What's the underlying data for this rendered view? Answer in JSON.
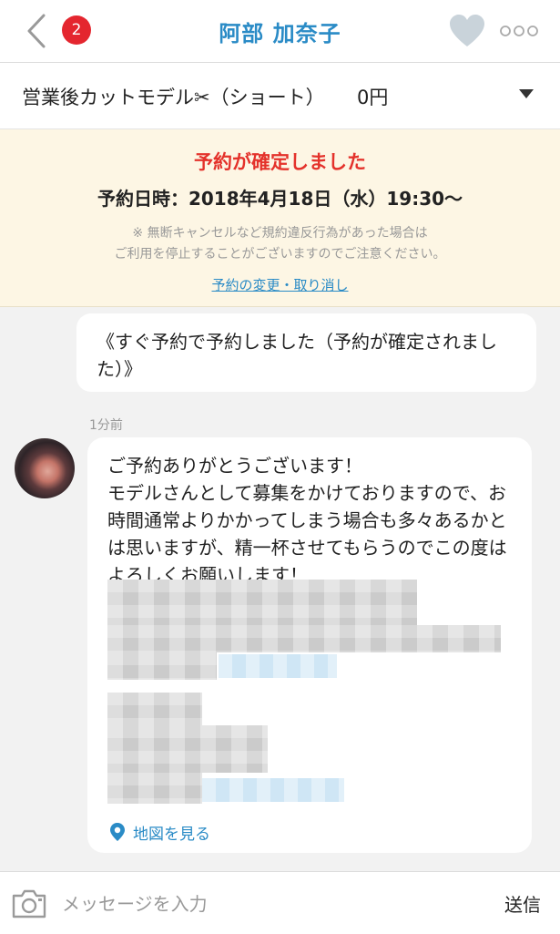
{
  "header": {
    "title": "阿部 加奈子",
    "unread_count": "2",
    "back_icon": "chevron-left-icon",
    "favorite_icon": "heart-icon",
    "more_icon": "more-dots-icon"
  },
  "menu": {
    "name": "営業後カットモデル✂︎（ショート）",
    "price": "0円",
    "dropdown_icon": "caret-down-icon"
  },
  "confirmation": {
    "title": "予約が確定しました",
    "datetime": "予約日時：2018年4月18日（水）19:30〜",
    "notice_line1": "※ 無断キャンセルなど規約違反行為があった場合は",
    "notice_line2": "ご利用を停止することがございますのでご注意ください。",
    "change_link": "予約の変更・取り消し"
  },
  "chat": {
    "system_message": "《すぐ予約で予約しました（予約が確定されました）》",
    "time_label": "1分前",
    "message": "ご予約ありがとうございます！\nモデルさんとして募集をかけておりますので、お時間通常よりかかってしまう場合も多々あるかとは思いますが、精一杯させてもらうのでこの度はよろしくお願いします！",
    "map_link": "地図を見る"
  },
  "input": {
    "placeholder": "メッセージを入力",
    "send_label": "送信"
  },
  "colors": {
    "accent": "#2a8bc6",
    "badge": "#e4262f",
    "confirm_title": "#e4322b",
    "confirm_bg": "#fdf6e4",
    "heart": "#c9d3da"
  }
}
